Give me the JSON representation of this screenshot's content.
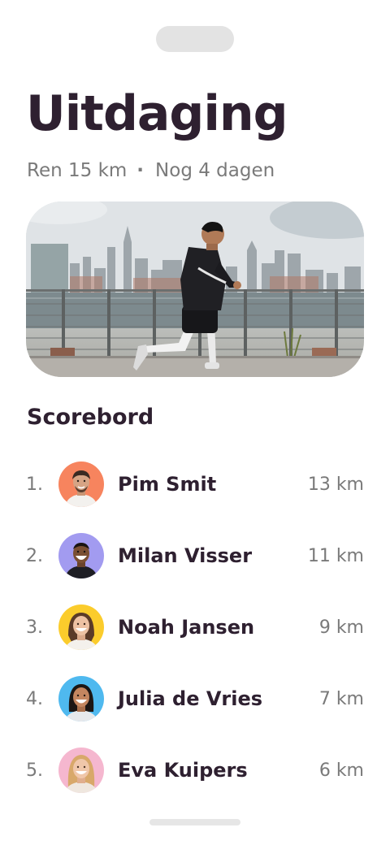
{
  "challenge": {
    "title": "Uitdaging",
    "activity": "Ren 15 km",
    "separator": "·",
    "time_left": "Nog 4 dagen"
  },
  "hero_image": {
    "icon": "runner-skyline-photo"
  },
  "scoreboard": {
    "title": "Scorebord",
    "entries": [
      {
        "rank": "1.",
        "name": "Pim Smit",
        "distance": "13 km",
        "avatar_color": "#f7845e"
      },
      {
        "rank": "2.",
        "name": "Milan Visser",
        "distance": "11 km",
        "avatar_color": "#a29bf0"
      },
      {
        "rank": "3.",
        "name": "Noah Jansen",
        "distance": "9 km",
        "avatar_color": "#fbcc2c"
      },
      {
        "rank": "4.",
        "name": "Julia de Vries",
        "distance": "7 km",
        "avatar_color": "#4fb9ef"
      },
      {
        "rank": "5.",
        "name": "Eva Kuipers",
        "distance": "6 km",
        "avatar_color": "#f5b7cf"
      }
    ]
  },
  "colors": {
    "text_primary": "#2e2030",
    "text_secondary": "#7a7a7a",
    "background": "#ffffff"
  }
}
